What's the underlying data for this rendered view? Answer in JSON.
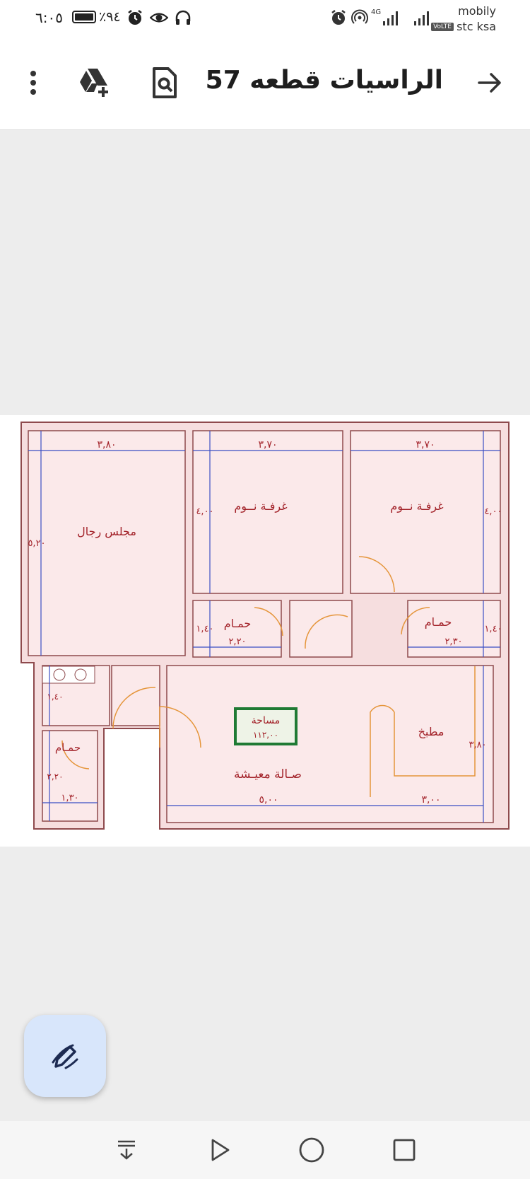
{
  "status_bar": {
    "time": "٦:٠٥",
    "battery": "٪٩٤",
    "network_type": "4G",
    "carrier_primary": "mobily",
    "carrier_secondary": "stc ksa",
    "volte_label": "VoLTE"
  },
  "app_bar": {
    "title": "الراسيات قطعه 57...",
    "back_icon": "arrow-forward-icon",
    "search_doc_icon": "document-search-icon",
    "drive_icon": "drive-add-icon",
    "more_icon": "more-vertical-icon"
  },
  "floor_plan": {
    "rooms": {
      "majlis": "مجلس رجال",
      "bedroom_middle": "غرفـة نــوم",
      "bedroom_right": "غرفـة نــوم",
      "bath_middle": "حمـام",
      "bath_right": "حمـام",
      "bath_left": "حمـام",
      "kitchen": "مطبخ",
      "living": "صـالة معيـشة"
    },
    "area_label": "مساحة",
    "area_value": "١١٢,٠٠",
    "dimensions": {
      "majlis_width": "٣,٨٠",
      "majlis_length": "٥,٢٠",
      "bed_middle_width": "٣,٧٠",
      "bed_middle_length": "٤,٠٠",
      "bed_right_width": "٣,٧٠",
      "bed_right_length": "٤,٠٠",
      "bath_middle_width": "٢,٢٠",
      "bath_middle_length": "١,٤٠",
      "bath_right_width": "٢,٣٠",
      "bath_right_length": "١,٤٠",
      "left_upper_length": "١,٤٠",
      "bath_left_length": "٢,٢٠",
      "bath_left_width": "١,٣٠",
      "living_width": "٥,٠٠",
      "kitchen_width": "٣,٠٠",
      "kitchen_length": "٣,٨٠"
    },
    "colors": {
      "wall_fill": "#f6dedf",
      "wall_line": "#8e4a4d",
      "text": "#a3232a",
      "dimension_line": "#3b4fc4",
      "door": "#e5953a",
      "area_box_border": "#1f7a34"
    }
  },
  "fab": {
    "icon": "edit-pen-icon"
  },
  "nav_bar": {
    "icons": [
      "keyboard-hide-icon",
      "back-triangle-icon",
      "home-circle-icon",
      "recents-square-icon"
    ]
  }
}
